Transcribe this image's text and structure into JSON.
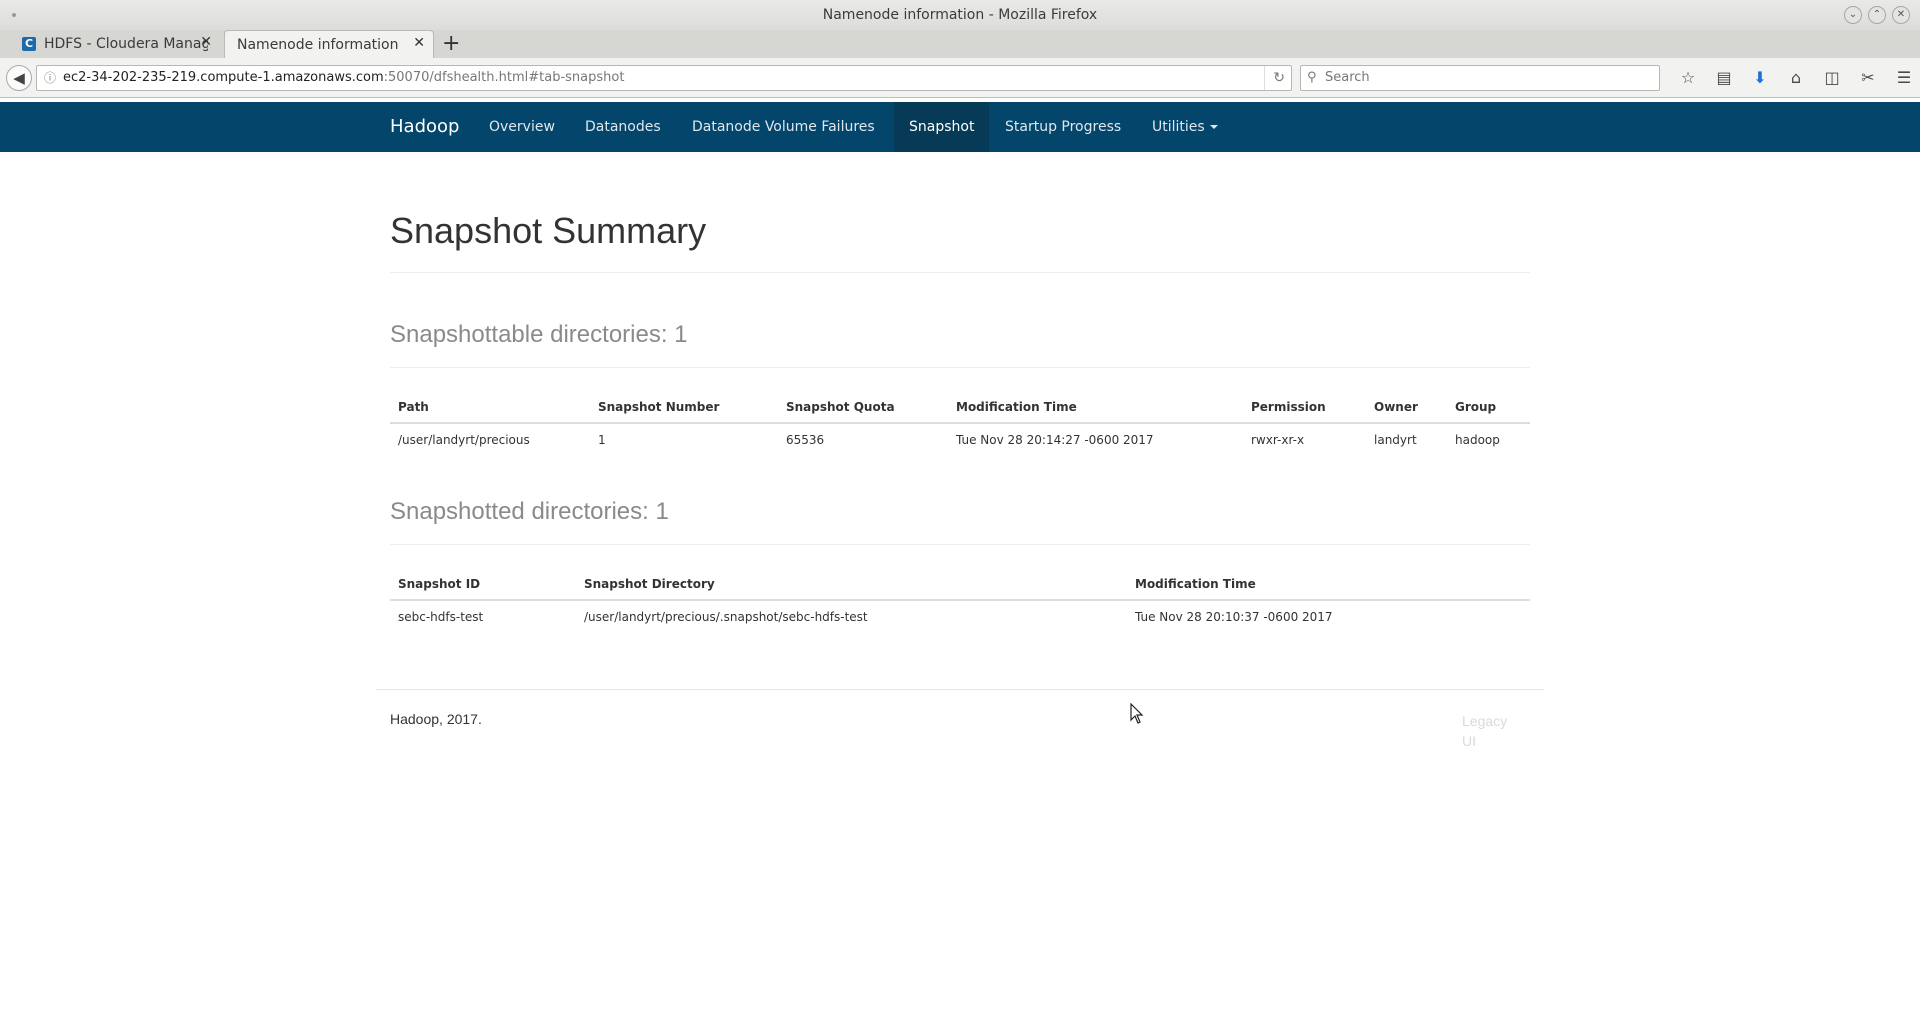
{
  "window": {
    "title": "Namenode information - Mozilla Firefox"
  },
  "tabs": [
    {
      "label": "HDFS - Cloudera Manage",
      "favicon": "C"
    },
    {
      "label": "Namenode information"
    }
  ],
  "urlbar": {
    "host": "ec2-34-202-235-219.compute-1.amazonaws.com",
    "rest": ":50070/dfshealth.html#tab-snapshot"
  },
  "search": {
    "placeholder": "Search"
  },
  "hadoop_nav": {
    "brand": "Hadoop",
    "items": [
      "Overview",
      "Datanodes",
      "Datanode Volume Failures",
      "Snapshot",
      "Startup Progress",
      "Utilities"
    ],
    "active": "Snapshot"
  },
  "page": {
    "title": "Snapshot Summary",
    "snapshottable": {
      "heading": "Snapshottable directories: 1",
      "columns": [
        "Path",
        "Snapshot Number",
        "Snapshot Quota",
        "Modification Time",
        "Permission",
        "Owner",
        "Group"
      ],
      "rows": [
        [
          "/user/landyrt/precious",
          "1",
          "65536",
          "Tue Nov 28 20:14:27 -0600 2017",
          "rwxr-xr-x",
          "landyrt",
          "hadoop"
        ]
      ]
    },
    "snapshotted": {
      "heading": "Snapshotted directories: 1",
      "columns": [
        "Snapshot ID",
        "Snapshot Directory",
        "Modification Time"
      ],
      "rows": [
        [
          "sebc-hdfs-test",
          "/user/landyrt/precious/.snapshot/sebc-hdfs-test",
          "Tue Nov 28 20:10:37 -0600 2017"
        ]
      ]
    }
  },
  "footer": {
    "left": "Hadoop, 2017.",
    "legacy": "Legacy UI"
  }
}
